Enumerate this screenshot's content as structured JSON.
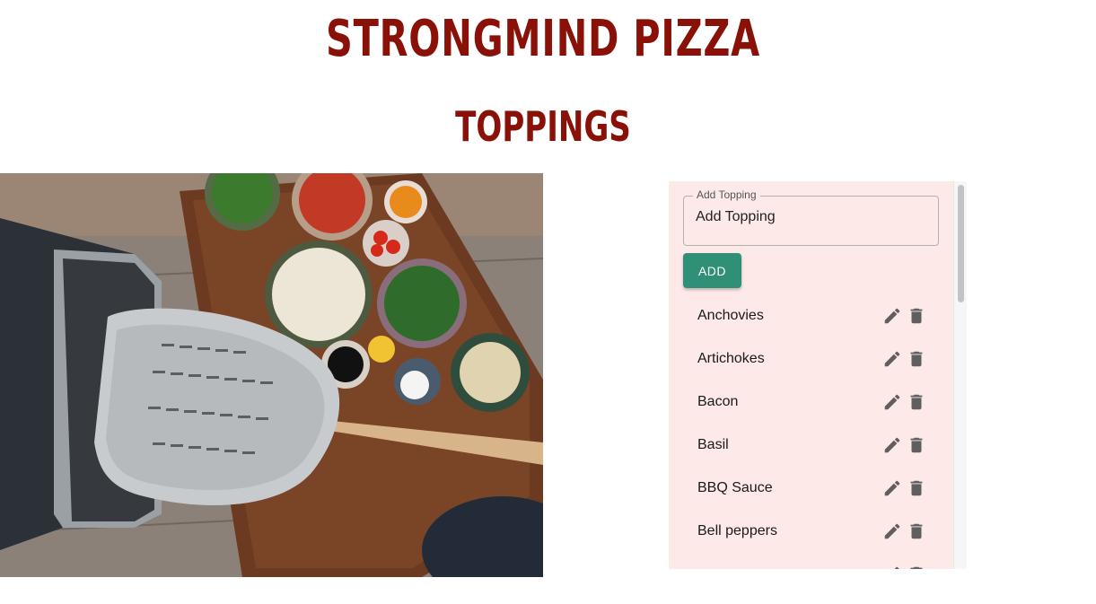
{
  "header": {
    "title": "STRONGMIND PIZZA",
    "subtitle": "TOPPINGS"
  },
  "colors": {
    "title": "#8a1108",
    "panel_bg": "#fde9e7",
    "add_button": "#2f8f77"
  },
  "image": {
    "icon": "pizza-oven-photo"
  },
  "form": {
    "label": "Add Topping",
    "placeholder": "Add Topping",
    "value": "",
    "add_label": "ADD"
  },
  "toppings": [
    "Anchovies",
    "Artichokes",
    "Bacon",
    "Basil",
    "BBQ Sauce",
    "Bell peppers",
    ""
  ],
  "item_icons": {
    "edit": "pencil-icon",
    "delete": "trash-icon"
  }
}
